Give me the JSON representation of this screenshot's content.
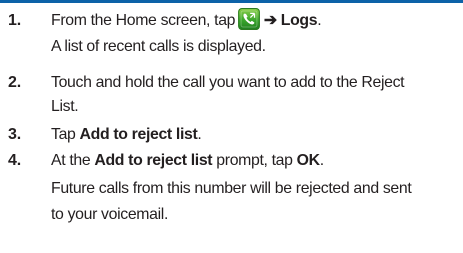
{
  "steps": [
    {
      "number": "1.",
      "line1_before": "From the Home screen, tap",
      "icon": "phone-icon",
      "arrow": "➔",
      "line1_bold": "Logs",
      "line1_after": ".",
      "note": "A list of recent calls is displayed."
    },
    {
      "number": "2.",
      "line1": "Touch and hold the call you want to add to the Reject",
      "line2": "List."
    },
    {
      "number": "3.",
      "before": "Tap ",
      "bold": "Add to reject list",
      "after": "."
    },
    {
      "number": "4.",
      "before": "At the ",
      "bold1": "Add to reject list",
      "middle": " prompt, tap ",
      "bold2": "OK",
      "after": ".",
      "note_line1": "Future calls from this number will be rejected and sent",
      "note_line2": "to your voicemail."
    }
  ],
  "colors": {
    "text": "#231f20",
    "top_strip": "#0c62a8",
    "icon_green": "#3aa62c"
  }
}
